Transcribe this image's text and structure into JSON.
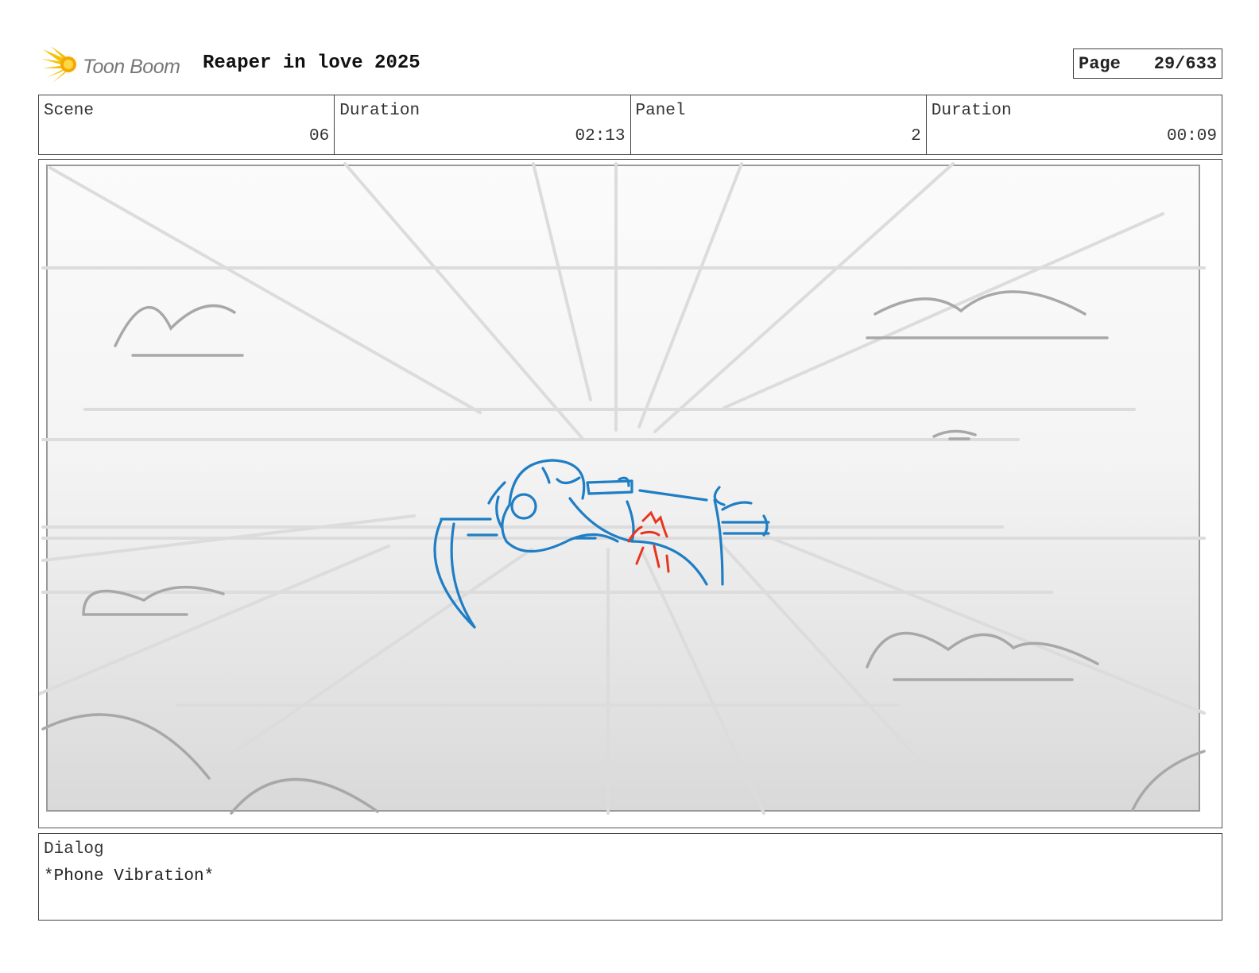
{
  "header": {
    "logo_text": "Toon Boom",
    "project_title": "Reaper in love 2025",
    "page_label": "Page",
    "page_value": "29/633"
  },
  "info": {
    "scene_label": "Scene",
    "scene_value": "06",
    "scene_duration_label": "Duration",
    "scene_duration_value": "02:13",
    "panel_label": "Panel",
    "panel_value": "2",
    "panel_duration_label": "Duration",
    "panel_duration_value": "00:09"
  },
  "panel": {
    "sketch_colors": {
      "character": "#1f7ec4",
      "effect": "#e8361e",
      "background": "#bdbdbd"
    }
  },
  "dialog": {
    "label": "Dialog",
    "text": "*Phone Vibration*"
  }
}
